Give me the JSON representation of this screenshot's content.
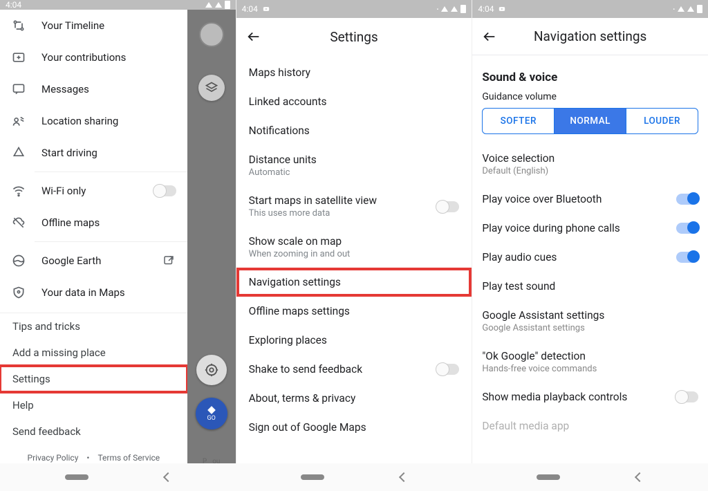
{
  "status": {
    "time": "4:04"
  },
  "panel1": {
    "items": [
      {
        "label": "Your Timeline"
      },
      {
        "label": "Your contributions"
      },
      {
        "label": "Messages"
      },
      {
        "label": "Location sharing"
      },
      {
        "label": "Start driving"
      }
    ],
    "wifi_only": "Wi-Fi only",
    "offline_maps": "Offline maps",
    "google_earth": "Google Earth",
    "your_data": "Your data in Maps",
    "text_items": [
      "Tips and tricks",
      "Add a missing place",
      "Settings",
      "Help",
      "Send feedback"
    ],
    "privacy": "Privacy Policy",
    "terms": "Terms of Service",
    "go_label": "GO",
    "behind_p": "P",
    "behind_you": "ou"
  },
  "panel2": {
    "title": "Settings",
    "items": [
      {
        "primary": "Maps history"
      },
      {
        "primary": "Linked accounts"
      },
      {
        "primary": "Notifications"
      },
      {
        "primary": "Distance units",
        "secondary": "Automatic"
      },
      {
        "primary": "Start maps in satellite view",
        "secondary": "This uses more data",
        "switch": "off"
      },
      {
        "primary": "Show scale on map",
        "secondary": "When zooming in and out"
      },
      {
        "primary": "Navigation settings",
        "highlight": true
      },
      {
        "primary": "Offline maps settings"
      },
      {
        "primary": "Exploring places"
      },
      {
        "primary": "Shake to send feedback",
        "switch": "off"
      },
      {
        "primary": "About, terms & privacy"
      },
      {
        "primary": "Sign out of Google Maps"
      }
    ]
  },
  "panel3": {
    "title": "Navigation settings",
    "section": "Sound & voice",
    "guidance_label": "Guidance volume",
    "seg": [
      "SOFTER",
      "NORMAL",
      "LOUDER"
    ],
    "seg_selected": 1,
    "voice_sel_label": "Voice selection",
    "voice_sel_value": "Default (English)",
    "items": [
      {
        "primary": "Play voice over Bluetooth",
        "switch": "on"
      },
      {
        "primary": "Play voice during phone calls",
        "switch": "on"
      },
      {
        "primary": "Play audio cues",
        "switch": "on"
      },
      {
        "primary": "Play test sound"
      },
      {
        "primary": "Google Assistant settings",
        "secondary": "Google Assistant settings"
      },
      {
        "primary": "\"Ok Google\" detection",
        "secondary": "Hands-free voice commands"
      },
      {
        "primary": "Show media playback controls",
        "switch": "off"
      },
      {
        "primary": "Default media app",
        "disabled": true
      }
    ]
  }
}
